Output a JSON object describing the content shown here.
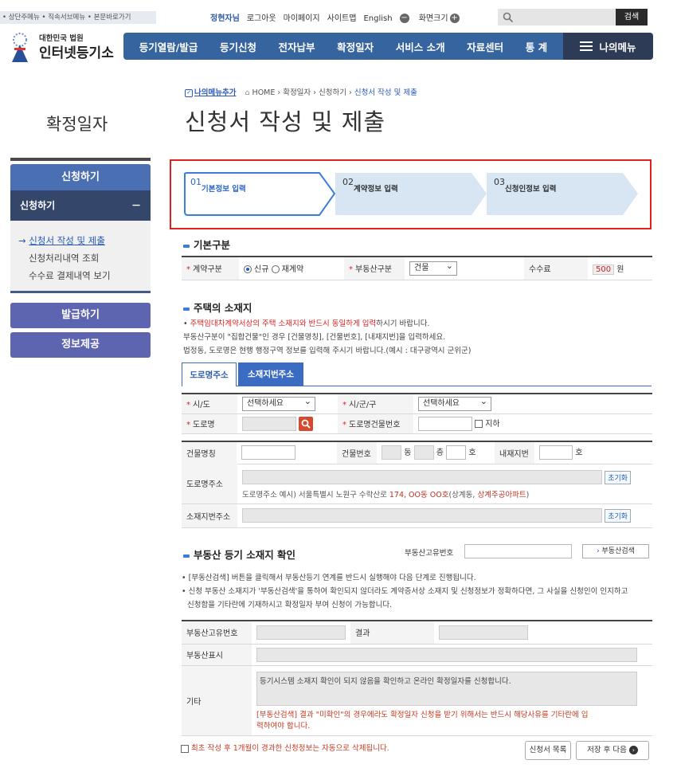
{
  "skip_links": "• 상단주메뉴 • 직속서브메뉴 • 본문바로가기",
  "topnav": {
    "user": "정현자님",
    "logout": "로그아웃",
    "mypage": "마이페이지",
    "sitemap": "사이트맵",
    "english": "English",
    "zoom": "화면크기",
    "search_btn": "검색"
  },
  "logo": {
    "line1": "대한민국 법원",
    "line2": "인터넷등기소"
  },
  "gnb": [
    "등기열람/발급",
    "등기신청",
    "전자납부",
    "확정일자",
    "서비스 소개",
    "자료센터",
    "통 계"
  ],
  "mymenu": "나의메뉴",
  "sidebar": {
    "title": "확정일자",
    "btn1": "신청하기",
    "active": "신청하기",
    "active_sign": "－",
    "items": [
      "신청서 작성 및 제출",
      "신청처리내역 조회",
      "수수료 결제내역 보기"
    ],
    "btn2": "발급하기",
    "btn3": "정보제공"
  },
  "breadcrumb": {
    "addmenu": "나의메뉴추가",
    "text": "HOME › 확정일자 › 신청하기 ›",
    "current": "신청서 작성 및 제출"
  },
  "page_title": "신청서 작성 및 제출",
  "steps": [
    {
      "num": "01",
      "label": "기본정보 입력"
    },
    {
      "num": "02",
      "label": "계약정보 입력"
    },
    {
      "num": "03",
      "label": "신청인정보 입력"
    }
  ],
  "basic": {
    "title": "기본구분",
    "contract_label": "계약구분",
    "opt_new": "신규",
    "opt_renew": "재계약",
    "prop_label": "부동산구분",
    "prop_value": "건물",
    "fee_label": "수수료",
    "fee_value": "500",
    "fee_unit": "원"
  },
  "address": {
    "title": "주택의 소재지",
    "note1_red": "주택임대차계약서상의 주택 소재지와 반드시 동일하게 입력",
    "note1_rest": "하시기 바랍니다.",
    "note2": "부동산구분이 \"집합건물\"인 경우 [건물명칭], [건물번호], [내재지번]을 입력하세요.",
    "note3": "법정동, 도로명은 현행 행정구역 정보를 입력해 주시기 바랍니다.(예시 : 대구광역시 군위군)",
    "tab1": "도로명주소",
    "tab2": "소재지번주소",
    "sido": "시/도",
    "sido_val": "선택하세요",
    "sigungu": "시/군/구",
    "sigungu_val": "선택하세요",
    "road": "도로명",
    "road_bldg": "도로명건물번호",
    "underground": "지하",
    "bldg_name": "건물명칭",
    "bldg_no": "건물번호",
    "dong": "동",
    "floor": "층",
    "ho": "호",
    "inner_no": "내재지번",
    "ho2": "호",
    "road_addr": "도로명주소",
    "reset": "초기화",
    "example_pre": "도로명주소 예시) 서울특별시 노원구 수락산로 ",
    "example_red": "174, OO동 OO호",
    "example_mid": "(상계동, ",
    "example_red2": "상계주공아파트",
    "example_post": ")",
    "jibun_addr": "소재지번주소"
  },
  "confirm": {
    "title": "부동산 등기 소재지 확인",
    "uid_label": "부동산고유번호",
    "search_btn": "부동산검색",
    "note1": "[부동산검색] 버튼을 클릭해서 부동산등기 연계를 반드시 실행해야 다음 단계로 진행됩니다.",
    "note2a": "신청 부동산 소재지가 '부동산검색'을 통하여 확인되지 않더라도 계약증서상 소재지 및 신청정보가 정확하다면, 그 사실을 신청인이 인지하고",
    "note2b": "신청함을 기타란에 기재하시고 확정일자 부여 신청이 가능합니다.",
    "t_uid": "부동산고유번호",
    "t_result": "결과",
    "t_disp": "부동산표시",
    "t_etc": "기타",
    "etc_text": "등기시스템 소재지 확인이 되지 않음을 확인하고 온라인 확정일자를 신청합니다.",
    "etc_warn1": "[부동산검색] 결과 \"미확인\"의 경우에라도 확정일자 신청을 받기 위해서는 반드시 해당사유를 기타란에 입",
    "etc_warn2": "력하여야 합니다."
  },
  "footer": {
    "delete_note": "최초 작성 후 1개월이 경과한 신청정보는 자동으로 삭제됩니다.",
    "list_btn": "신청서 목록",
    "next_btn": "저장 후 다음"
  }
}
